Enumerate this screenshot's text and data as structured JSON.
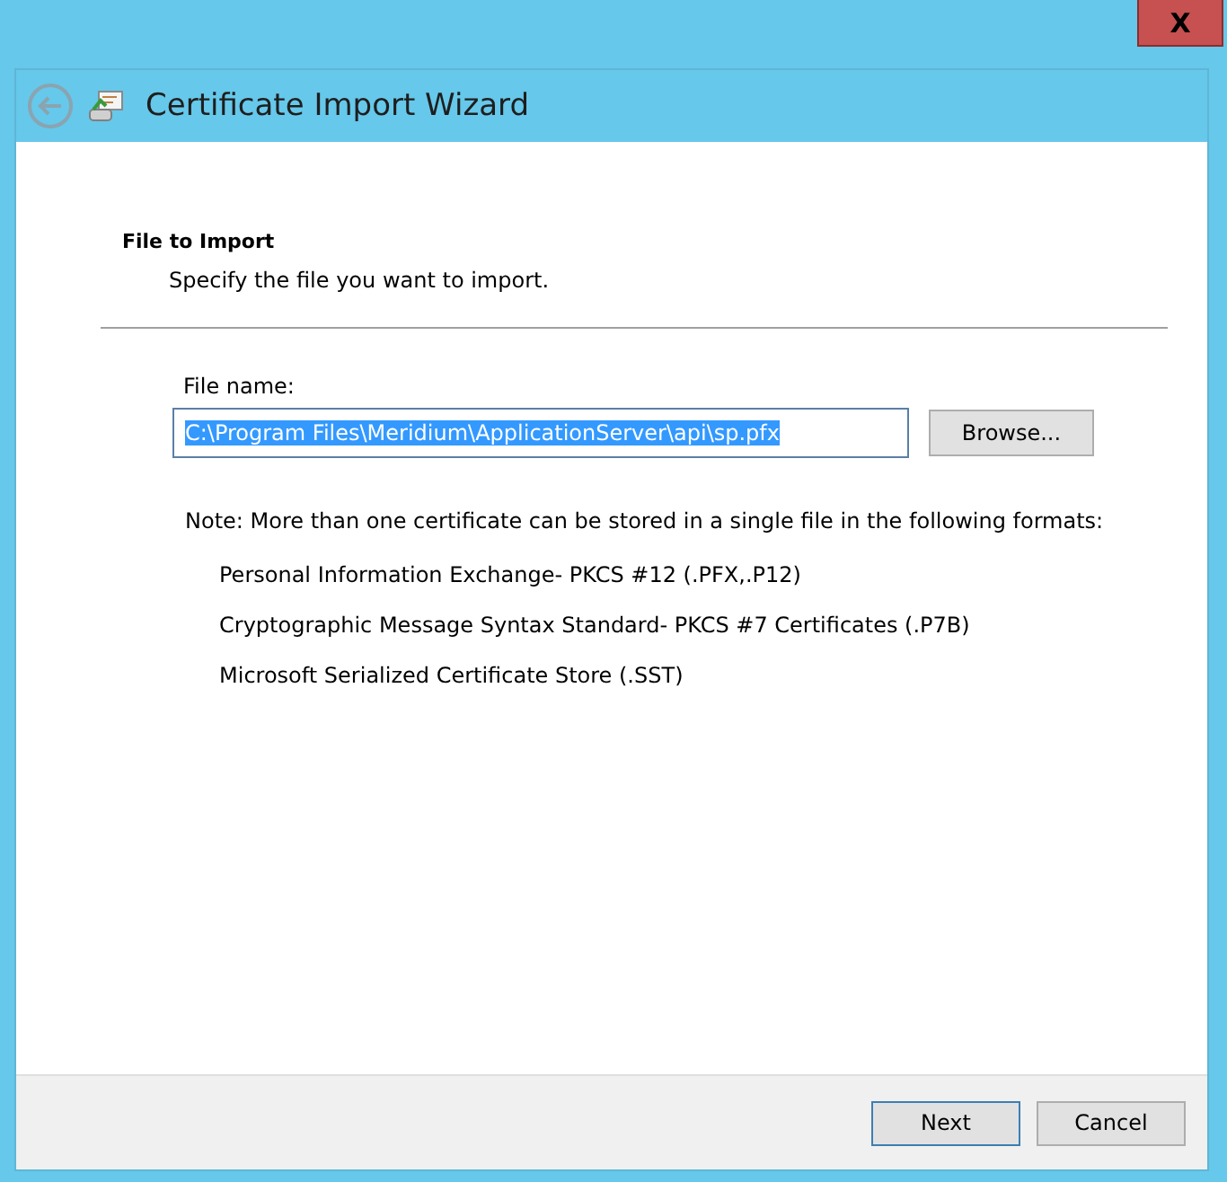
{
  "window": {
    "title": "Certificate Import Wizard",
    "close_label": "X"
  },
  "page": {
    "heading": "File to Import",
    "subheading": "Specify the file you want to import."
  },
  "file_field": {
    "label": "File name:",
    "value": "C:\\Program Files\\Meridium\\ApplicationServer\\api\\sp.pfx",
    "text_selected": true,
    "browse_button": "Browse..."
  },
  "note": "Note:  More than one certificate can be stored in a single file in the following formats:",
  "formats": [
    "Personal Information Exchange- PKCS #12 (.PFX,.P12)",
    "Cryptographic Message Syntax Standard- PKCS #7 Certificates (.P7B)",
    "Microsoft Serialized Certificate Store (.SST)"
  ],
  "buttons": [
    {
      "label": "Next",
      "default": true
    },
    {
      "label": "Cancel",
      "default": false
    }
  ]
}
